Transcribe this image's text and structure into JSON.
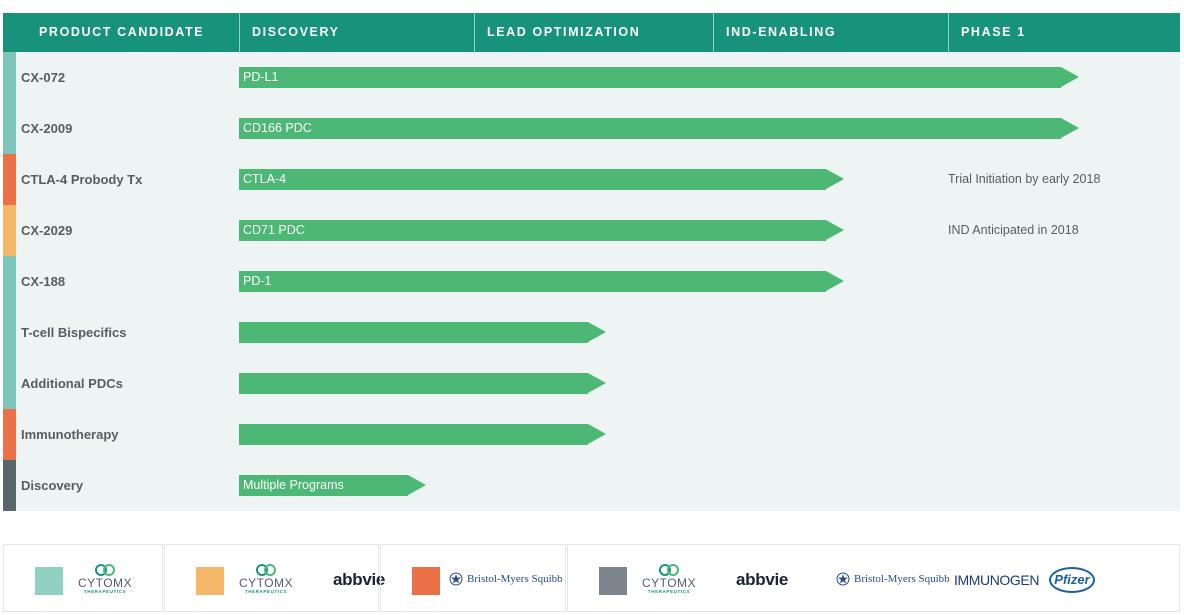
{
  "header": {
    "columns": [
      "PRODUCT CANDIDATE",
      "DISCOVERY",
      "LEAD OPTIMIZATION",
      "IND-ENABLING",
      "PHASE 1"
    ]
  },
  "rows": [
    {
      "name": "CX-072",
      "bar_label": "PD-L1",
      "stage_progress": 3.55,
      "note": "",
      "stripe_color": "#7dc6bb"
    },
    {
      "name": "CX-2009",
      "bar_label": "CD166 PDC",
      "stage_progress": 3.55,
      "note": "",
      "stripe_color": "#7dc6bb"
    },
    {
      "name": "CTLA-4 Probody Tx",
      "bar_label": "CTLA-4",
      "stage_progress": 2.56,
      "note": "Trial Initiation by early 2018",
      "stripe_color": "#ea7048"
    },
    {
      "name": "CX-2029",
      "bar_label": "CD71 PDC",
      "stage_progress": 2.56,
      "note": "IND Anticipated in 2018",
      "stripe_color": "#f5b86a"
    },
    {
      "name": "CX-188",
      "bar_label": "PD-1",
      "stage_progress": 2.56,
      "note": "",
      "stripe_color": "#7dc6bb"
    },
    {
      "name": "T-cell Bispecifics",
      "bar_label": "",
      "stage_progress": 1.55,
      "note": "",
      "stripe_color": "#7dc6bb"
    },
    {
      "name": "Additional PDCs",
      "bar_label": "",
      "stage_progress": 1.55,
      "note": "",
      "stripe_color": "#7dc6bb"
    },
    {
      "name": "Immunotherapy",
      "bar_label": "",
      "stage_progress": 1.55,
      "note": "",
      "stripe_color": "#ea7048"
    },
    {
      "name": "Discovery",
      "bar_label": "Multiple Programs",
      "stage_progress": 0.79,
      "note": "",
      "stripe_color": "#56666d"
    }
  ],
  "partners": {
    "groups": [
      {
        "swatch_color": "#8fd0c0",
        "logos": [
          "cytomx"
        ]
      },
      {
        "swatch_color": "#f5b86a",
        "logos": [
          "cytomx",
          "abbvie"
        ]
      },
      {
        "swatch_color": "#ea7048",
        "logos": [
          "bms"
        ]
      },
      {
        "swatch_color": "#7d868c",
        "logos": [
          "cytomx",
          "abbvie",
          "bms",
          "immunogen",
          "pfizer"
        ]
      }
    ],
    "cytomx_name": "CYTOMX",
    "cytomx_sub": "THERAPEUTICS",
    "abbvie_name": "abbvie",
    "bms_name": "Bristol-Myers Squibb",
    "immunogen_name": "IMMUNOGEN",
    "pfizer_name": "Pfizer"
  },
  "colors": {
    "header_bg": "#16937a",
    "bar": "#4db876",
    "grid_bg": "#eef4f4"
  }
}
